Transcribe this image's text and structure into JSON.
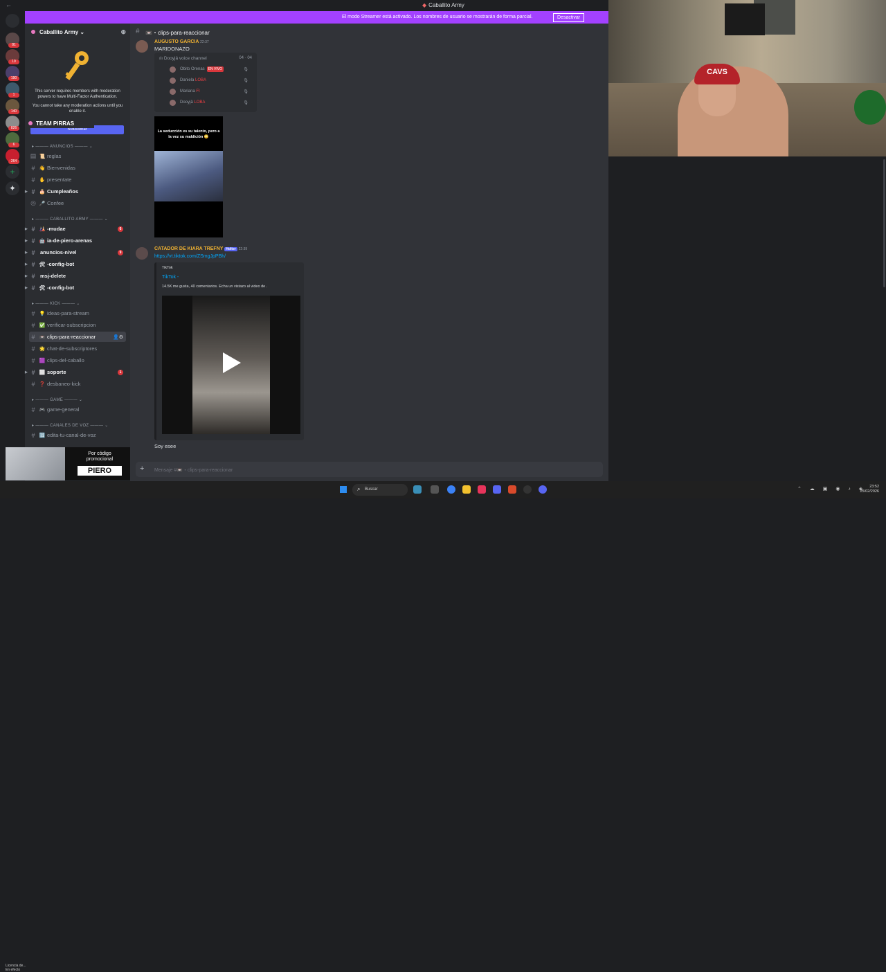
{
  "titlebar": {
    "title": "Caballito Army",
    "back": "←"
  },
  "streamer_banner": {
    "text": "El modo Streamer está activado. Los nombres de usuario se mostrarán de forma parcial.",
    "button": "Desactivar",
    "color": "#a341ff"
  },
  "guilds": {
    "badges": [
      "81",
      "19",
      "190",
      "1",
      "140",
      "826",
      "6",
      "1",
      "264"
    ],
    "add_icon": "+",
    "explore_icon": "compass-icon"
  },
  "server": {
    "name": "Caballito Army",
    "chevron": "⌄"
  },
  "mfa_notice": {
    "line1": "This server requires members with moderation powers to have Multi-Factor Authentication.",
    "line2": "You cannot take any moderation actions until you enable it.",
    "button": "Solucionar"
  },
  "tooltip": {
    "label": "TEAM PIRRAS"
  },
  "categories": {
    "anuncios": "ANUNCIOS",
    "army": "CABALLITO ARMY",
    "kick": "KICK",
    "game": "GAME",
    "voz": "CANALES DE VOZ"
  },
  "channels": [
    {
      "name": "reglas",
      "emoji": "📜"
    },
    {
      "name": "Bienvenidas",
      "emoji": "👋"
    },
    {
      "name": "presentate",
      "emoji": "✋"
    },
    {
      "name": "Cumpleaños",
      "emoji": "🎂"
    },
    {
      "name": "Confee",
      "emoji": "🎤"
    },
    {
      "name": "-mudae",
      "emoji": "🎎",
      "badge": "6"
    },
    {
      "name": "ia-de-piero-arenas",
      "emoji": "🤖"
    },
    {
      "name": "anuncios-nivel",
      "emoji": "",
      "badge": "9"
    },
    {
      "name": "-config-bot",
      "emoji": "🛠"
    },
    {
      "name": "msj-delete",
      "emoji": ""
    },
    {
      "name": "-config-bot",
      "emoji": "🛠"
    },
    {
      "name": "ideas-para-stream",
      "emoji": "💡"
    },
    {
      "name": "verificar-subscripcion",
      "emoji": "✅"
    },
    {
      "name": "clips-para-reaccionar",
      "emoji": "📼"
    },
    {
      "name": "chat-de-subscriptores",
      "emoji": "🌟"
    },
    {
      "name": "clips-del-caballo",
      "emoji": "🟪"
    },
    {
      "name": "soporte",
      "emoji": "⬜",
      "badge": "1"
    },
    {
      "name": "desbaneo-kick",
      "emoji": "❓"
    },
    {
      "name": "game-general",
      "emoji": "🎮"
    },
    {
      "name": "edita-tu-canal-de-voz",
      "emoji": "🔢"
    }
  ],
  "promo": {
    "line1": "Por código",
    "line2": "promocional",
    "code": "PIERO"
  },
  "bottom_left": {
    "line1": "Licencia de...",
    "line2": "En efecto"
  },
  "chat": {
    "channel": "clips-para-reaccionar",
    "messages": [
      {
        "user": "AUGUSTO GARCIA",
        "time": "22:37",
        "text": "MARIDONAZO"
      },
      {
        "user": "CATADOR DE KIARA TREFNY",
        "tag": "Holter",
        "time": "22:39",
        "link": "https://vt.tiktok.com/ZSmgJpPBh/"
      }
    ],
    "voice": {
      "title": "Dooyjä voice channel",
      "count": "04 · 04",
      "members": [
        {
          "name": "Obito Orenas",
          "live": "EN VIVO"
        },
        {
          "name": "Daniela",
          "tag": "LOBA"
        },
        {
          "name": "Mariana",
          "tag": "FI"
        },
        {
          "name": "Dooyjä",
          "tag": "LOBA"
        }
      ]
    },
    "video_caption": "La seducción es su talento, pero a la vez su maldición 😳",
    "embed": {
      "source": "TikTok",
      "title": "TikTok -",
      "desc": "14.5K me gusta, 40 comentarios. Echa un vistazo al video de ."
    },
    "last_text": "Soy esee",
    "composer_placeholder": "Mensaje #📼・clips-para-reaccionar"
  },
  "taskbar": {
    "search": "Buscar",
    "time": "23:52",
    "date": "25/02/2026"
  }
}
